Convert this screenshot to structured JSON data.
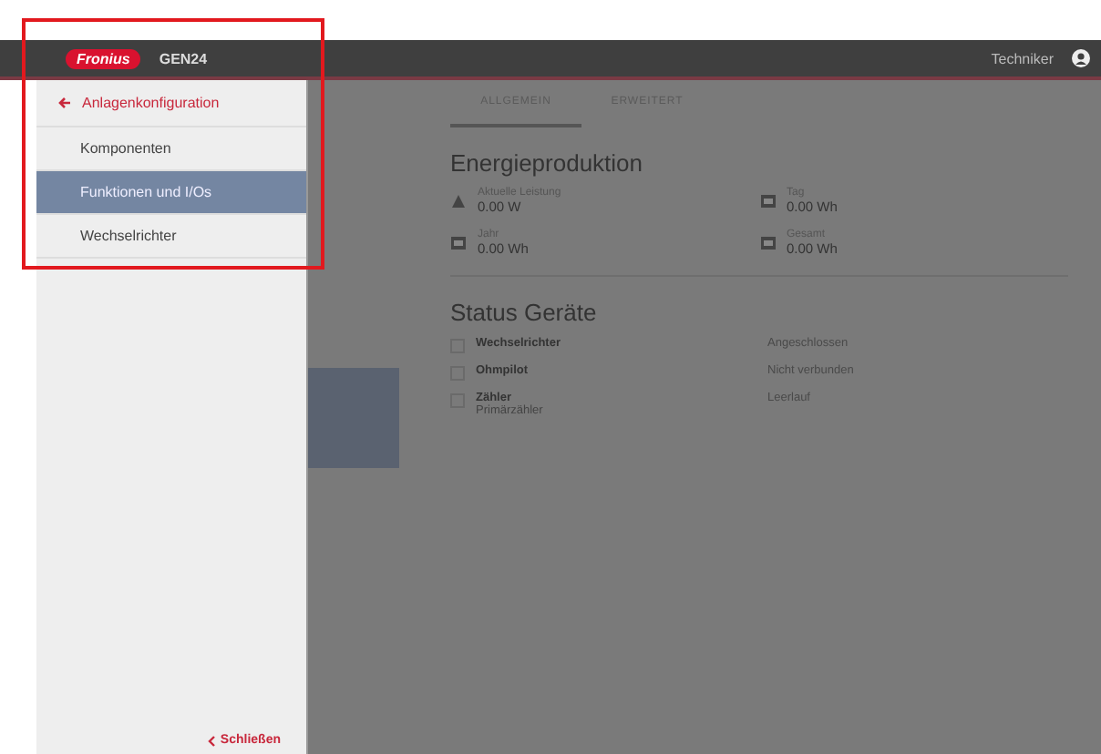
{
  "header": {
    "logo": "Fronius",
    "device": "GEN24",
    "user": "Techniker"
  },
  "sidebar": {
    "back": "Anlagenkonfiguration",
    "items": [
      {
        "label": "Komponenten",
        "selected": false
      },
      {
        "label": "Funktionen und I/Os",
        "selected": true
      },
      {
        "label": "Wechselrichter",
        "selected": false
      }
    ],
    "footer": "Schließen"
  },
  "tabs": [
    {
      "label": "ALLGEMEIN",
      "selected": true
    },
    {
      "label": "ERWEITERT",
      "selected": false
    }
  ],
  "energy": {
    "title": "Energieproduktion",
    "items": [
      {
        "label": "Aktuelle Leistung",
        "value": "0.00 W"
      },
      {
        "label": "Tag",
        "value": "0.00 Wh"
      },
      {
        "label": "Jahr",
        "value": "0.00 Wh"
      },
      {
        "label": "Gesamt",
        "value": "0.00 Wh"
      }
    ]
  },
  "devices": {
    "title": "Status Geräte",
    "rows": [
      {
        "name": "Wechselrichter",
        "status": "Angeschlossen"
      },
      {
        "name": "Ohmpilot",
        "status": "Nicht verbunden"
      },
      {
        "name": "Zähler",
        "sub": "Primärzähler",
        "status": "Leerlauf"
      }
    ]
  }
}
